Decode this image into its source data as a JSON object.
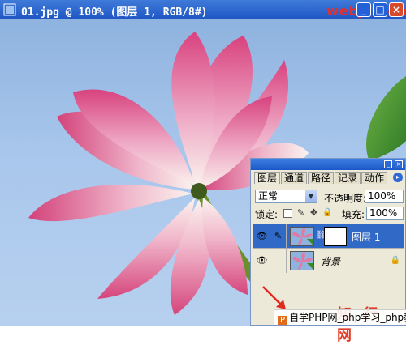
{
  "window": {
    "title": "01.jpg @ 100% (图层 1, RGB/8#)",
    "watermark_top": "webjx.com",
    "buttons": [
      "_",
      "□",
      "×"
    ]
  },
  "palette": {
    "tabs": [
      "图层",
      "通道",
      "路径",
      "记录",
      "动作"
    ],
    "blend_mode": "正常",
    "opacity_label": "不透明度:",
    "opacity_value": "100%",
    "lock_label": "锁定:",
    "fill_label": "填充:",
    "fill_value": "100%",
    "layers": [
      {
        "name": "图层 1",
        "selected": true
      },
      {
        "name": "背景",
        "selected": false
      }
    ]
  },
  "footer": {
    "watermark_brand": "知 行 网",
    "site_text": "自学PHP网_php学习_php教"
  }
}
